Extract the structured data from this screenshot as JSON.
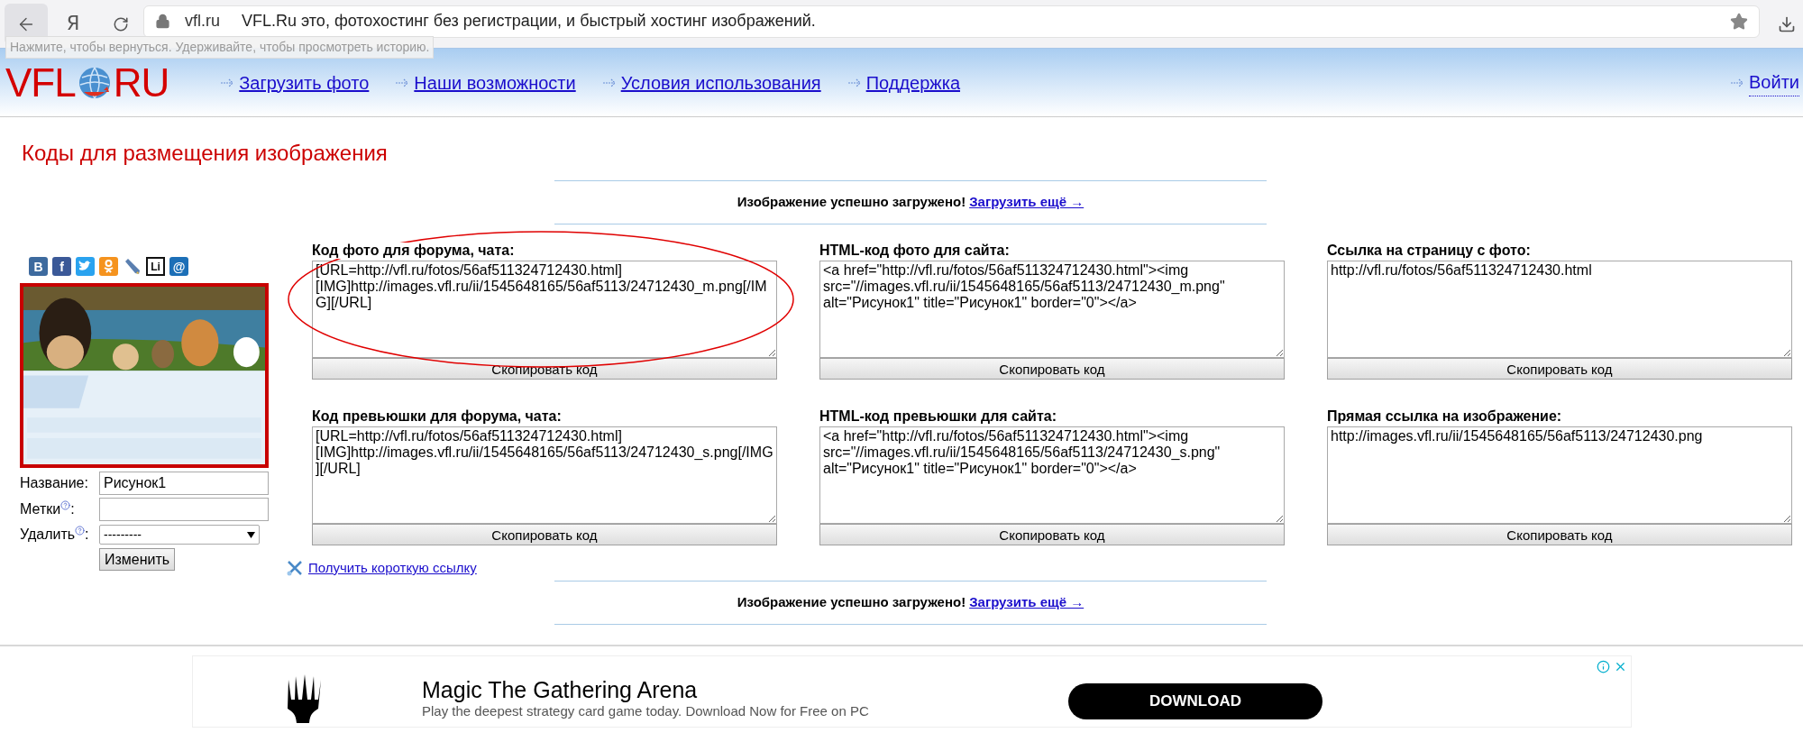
{
  "browser": {
    "domain": "vfl.ru",
    "page_title": "VFL.Ru это, фотохостинг без регистрации, и быстрый хостинг изображений.",
    "back_tooltip": "Нажмите, чтобы вернуться. Удерживайте, чтобы просмотреть историю.",
    "yandex_button": "Я"
  },
  "header": {
    "logo_left": "VFL",
    "logo_right": "RU",
    "nav": [
      "Загрузить фото",
      "Наши возможности",
      "Условия использования",
      "Поддержка"
    ],
    "login": "Войти"
  },
  "page_title": "Коды для размещения изображения",
  "upload_messages": [
    {
      "text": "Изображение успешно загружено!",
      "link": "Загрузить ещё →"
    },
    {
      "text": "Изображение успешно загружено!",
      "link": "Загрузить ещё →"
    }
  ],
  "share_icons": [
    {
      "kind": "letter",
      "glyph": "B",
      "color": "#3d6a9e"
    },
    {
      "kind": "letter",
      "glyph": "f",
      "color": "#3b5998"
    },
    {
      "kind": "bird",
      "color": "#2aa3ef"
    },
    {
      "kind": "person",
      "color": "#f5931e"
    },
    {
      "kind": "pencil",
      "color": "#5a7fb0"
    },
    {
      "kind": "outline",
      "glyph": "Li",
      "color": "#111111"
    },
    {
      "kind": "letter",
      "glyph": "@",
      "color": "#1c6fb7"
    }
  ],
  "image_form": {
    "fields": [
      {
        "label": "Название:",
        "kind": "text",
        "value": "Рисунок1",
        "help": false
      },
      {
        "label": "Метки",
        "kind": "text",
        "help": true,
        "suffix": ":"
      },
      {
        "label": "Удалить",
        "kind": "select",
        "value": "---------",
        "help": true,
        "suffix": ":"
      }
    ],
    "submit": "Изменить"
  },
  "code_blocks": [
    {
      "label": "Код фото для форума, чата:",
      "code": "[URL=http://vfl.ru/fotos/56af511324712430.html][IMG]http://images.vfl.ru/ii/1545648165/56af5113/24712430_m.png[/IMG][/URL]",
      "button": "Скопировать код",
      "circled": true
    },
    {
      "label": "HTML-код фото для сайта:",
      "code": "<a href=\"http://vfl.ru/fotos/56af511324712430.html\"><img src=\"//images.vfl.ru/ii/1545648165/56af5113/24712430_m.png\" alt=\"Рисунок1\" title=\"Рисунок1\" border=\"0\"></a>",
      "button": "Скопировать код",
      "circled": false
    },
    {
      "label": "Ссылка на страницу с фото:",
      "code": "http://vfl.ru/fotos/56af511324712430.html",
      "button": "Скопировать код",
      "circled": false
    },
    {
      "label": "Код превьюшки для форума, чата:",
      "code": "[URL=http://vfl.ru/fotos/56af511324712430.html][IMG]http://images.vfl.ru/ii/1545648165/56af5113/24712430_s.png[/IMG][/URL]",
      "button": "Скопировать код",
      "circled": false
    },
    {
      "label": "HTML-код превьюшки для сайта:",
      "code": "<a href=\"http://vfl.ru/fotos/56af511324712430.html\"><img src=\"//images.vfl.ru/ii/1545648165/56af5113/24712430_s.png\" alt=\"Рисунок1\" title=\"Рисунок1\" border=\"0\"></a>",
      "button": "Скопировать код",
      "circled": false
    },
    {
      "label": "Прямая ссылка на изображение:",
      "code": "http://images.vfl.ru/ii/1545648165/56af5113/24712430.png",
      "button": "Скопировать код",
      "circled": false
    }
  ],
  "short_link": "Получить короткую ссылку",
  "ad": {
    "title": "Magic The Gathering Arena",
    "text": "Play the deepest strategy card game today. Download Now for Free on PC",
    "button": "DOWNLOAD"
  }
}
